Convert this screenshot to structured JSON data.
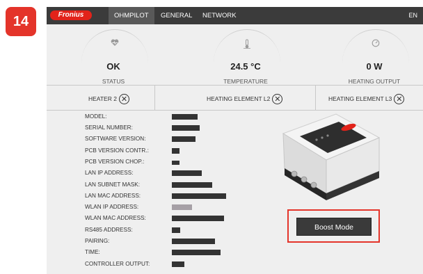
{
  "step_number": "14",
  "brand": "Fronius",
  "nav": {
    "tabs": [
      "OHMPILOT",
      "GENERAL",
      "NETWORK"
    ],
    "active": "OHMPILOT",
    "language": "EN"
  },
  "status": [
    {
      "icon": "heart-pulse-icon",
      "value": "OK",
      "label": "STATUS"
    },
    {
      "icon": "thermometer-icon",
      "value": "24.5 °C",
      "label": "TEMPERATURE"
    },
    {
      "icon": "gauge-icon",
      "value": "0 W",
      "label": "HEATING OUTPUT"
    }
  ],
  "heaters": [
    {
      "label": "HEATER 2"
    },
    {
      "label": "HEATING ELEMENT L2"
    },
    {
      "label": "HEATING ELEMENT L3"
    }
  ],
  "info": {
    "labels": [
      "MODEL:",
      "SERIAL NUMBER:",
      "SOFTWARE VERSION:",
      "PCB VERSION CONTR.:",
      "PCB VERSION CHOP.:",
      "LAN IP ADDRESS:",
      "LAN SUBNET MASK:",
      "LAN MAC ADDRESS:",
      "WLAN IP ADDRESS:",
      "WLAN MAC ADDRESS:",
      "RS485 ADDRESS:",
      "PAIRING:",
      "TIME:",
      "CONTROLLER OUTPUT:"
    ],
    "values_redacted": true
  },
  "boost_button_label": "Boost Mode",
  "colors": {
    "accent_red": "#e4342a",
    "topbar": "#3b3b3b",
    "panel": "#efefef",
    "redaction": "#333333"
  }
}
